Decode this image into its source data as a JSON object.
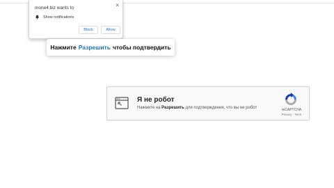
{
  "notification_popup": {
    "title": "mone4.biz wants to",
    "close_glyph": "×",
    "permission_label": "Show notifications",
    "permission_icon": "bell-icon",
    "block_label": "Block",
    "allow_label": "Allow"
  },
  "banner": {
    "prefix": "Нажмите",
    "accent": "Разрешить",
    "suffix": "чтобы подтвердить",
    "accent_color": "#1a73b8"
  },
  "captcha": {
    "icon": "browser-window-icon",
    "title": "Я не робот",
    "subtitle_prefix": "Нажмите на",
    "subtitle_bold": "Разрешить",
    "subtitle_suffix": "для подтверждения, что вы не робот",
    "brand_label": "reCAPTCHA",
    "terms_text": "Privacy - Term",
    "logo_icon": "recaptcha-logo-icon",
    "logo_colors": [
      "#1c3aa9",
      "#4285f4",
      "#ababab"
    ]
  }
}
